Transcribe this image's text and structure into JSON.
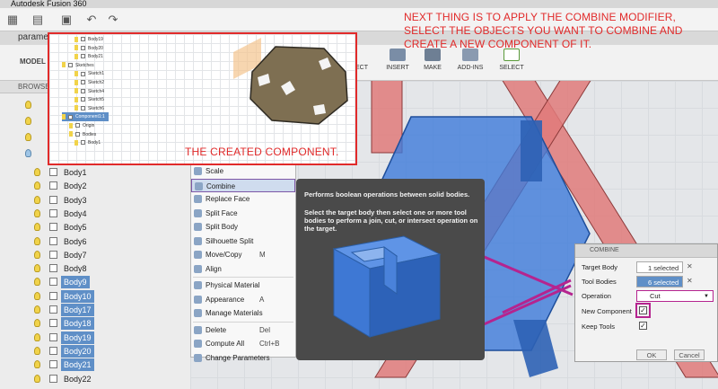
{
  "window": {
    "title": "Autodesk Fusion 360"
  },
  "document": {
    "tab_label": "parame"
  },
  "ribbon": {
    "workspace": "MODEL",
    "buttons": [
      {
        "label": "INSERT",
        "icon": "insert-icon"
      },
      {
        "label": "MAKE",
        "icon": "make-icon"
      },
      {
        "label": "ADD-INS",
        "icon": "addins-icon"
      },
      {
        "label": "SELECT",
        "icon": "select-icon"
      }
    ],
    "truncated_label": "ECT"
  },
  "browser": {
    "header": "BROWSER",
    "bodies": [
      {
        "name": "Body1",
        "selected": false
      },
      {
        "name": "Body2",
        "selected": false
      },
      {
        "name": "Body3",
        "selected": false
      },
      {
        "name": "Body4",
        "selected": false
      },
      {
        "name": "Body5",
        "selected": false
      },
      {
        "name": "Body6",
        "selected": false
      },
      {
        "name": "Body7",
        "selected": false
      },
      {
        "name": "Body8",
        "selected": false
      },
      {
        "name": "Body9",
        "selected": true
      },
      {
        "name": "Body10",
        "selected": true
      },
      {
        "name": "Body17",
        "selected": true
      },
      {
        "name": "Body18",
        "selected": true
      },
      {
        "name": "Body19",
        "selected": true
      },
      {
        "name": "Body20",
        "selected": true
      },
      {
        "name": "Body21",
        "selected": true
      },
      {
        "name": "Body22",
        "selected": false
      }
    ]
  },
  "context_menu": {
    "items": [
      {
        "label": "Scale",
        "shortcut": "",
        "icon": "scale-icon"
      },
      {
        "label": "Combine",
        "shortcut": "",
        "icon": "combine-icon",
        "highlighted": true
      },
      {
        "label": "Replace Face",
        "shortcut": "",
        "icon": "replace-face-icon"
      },
      {
        "label": "Split Face",
        "shortcut": "",
        "icon": "split-face-icon"
      },
      {
        "label": "Split Body",
        "shortcut": "",
        "icon": "split-body-icon"
      },
      {
        "label": "Silhouette Split",
        "shortcut": "",
        "icon": "silhouette-split-icon"
      },
      {
        "label": "Move/Copy",
        "shortcut": "M",
        "icon": "move-icon"
      },
      {
        "label": "Align",
        "shortcut": "",
        "icon": "align-icon"
      },
      {
        "label": "Physical Material",
        "shortcut": "",
        "icon": "physical-material-icon"
      },
      {
        "label": "Appearance",
        "shortcut": "A",
        "icon": "appearance-icon"
      },
      {
        "label": "Manage Materials",
        "shortcut": "",
        "icon": "manage-materials-icon"
      },
      {
        "label": "Delete",
        "shortcut": "Del",
        "icon": "delete-icon"
      },
      {
        "label": "Compute All",
        "shortcut": "Ctrl+B",
        "icon": "compute-all-icon"
      },
      {
        "label": "Change Parameters",
        "shortcut": "",
        "icon": "change-parameters-icon"
      }
    ]
  },
  "tooltip": {
    "title": "Performs boolean operations between solid bodies.",
    "body": "Select the target body then select one or more tool bodies to perform a join, cut, or intersect operation on the target."
  },
  "combine_dialog": {
    "title": "COMBINE",
    "target_label": "Target Body",
    "target_value": "1 selected",
    "tool_label": "Tool Bodies",
    "tool_value": "6 selected",
    "operation_label": "Operation",
    "operation_value": "Cut",
    "new_component_label": "New Component",
    "new_component_checked": true,
    "keep_tools_label": "Keep Tools",
    "keep_tools_checked": true,
    "ok_label": "OK",
    "cancel_label": "Cancel"
  },
  "inset": {
    "caption": "THE CREATED COMPONENT.",
    "tree": [
      {
        "label": "Body19"
      },
      {
        "label": "Body20"
      },
      {
        "label": "Body21"
      },
      {
        "label": "Sketches"
      },
      {
        "label": "Sketch1"
      },
      {
        "label": "Sketch2"
      },
      {
        "label": "Sketch4"
      },
      {
        "label": "Sketch5"
      },
      {
        "label": "Sketch6"
      },
      {
        "label": "Component1:1"
      },
      {
        "label": "Origin"
      },
      {
        "label": "Bodies"
      },
      {
        "label": "Body1"
      }
    ]
  },
  "annotation": {
    "text": "NEXT THING IS TO APPLY THE COMBINE MODIFIER, SELECT THE OBJECTS YOU WANT TO COMBINE AND CREATE A NEW COMPONENT OF IT."
  },
  "colors": {
    "annotation_red": "#e12a2a",
    "highlight_purple": "#7d57a7",
    "magenta_pointer": "#b5248f",
    "selection_blue": "#5f8fc7"
  }
}
